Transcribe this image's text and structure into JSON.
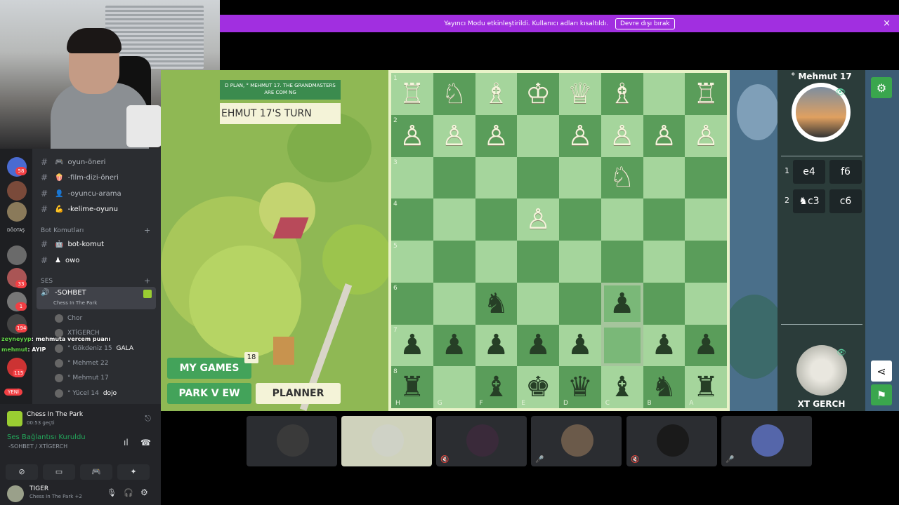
{
  "banner": {
    "message": "Yayıncı Modu etkinleştirildi. Kullanıcı adları kısaltıldı.",
    "disable_button": "Devre dışı bırak",
    "close_icon": "×"
  },
  "sidebar": {
    "channels": [
      {
        "icon": "🎮",
        "label": "oyun-öneri"
      },
      {
        "icon": "🍿",
        "label": "-film-dizi-öneri"
      },
      {
        "icon": "👤",
        "label": "-oyuncu-arama"
      },
      {
        "icon": "💪",
        "label": "-kelime-oyunu"
      }
    ],
    "server_label": "DĞOTAŞ",
    "server_badges": [
      "58",
      "33",
      "1",
      "194",
      "115"
    ],
    "new_badge": "YENİ",
    "category_bots": "Bot Komutları",
    "bot_channels": [
      {
        "icon": "🤖",
        "label": "bot-komut"
      },
      {
        "icon": "♟",
        "label": "owo"
      }
    ],
    "category_voice": "SES",
    "voice_channel": {
      "label": "-SOHBET",
      "activity": "Chess In The Park"
    },
    "voice_users": [
      {
        "name": "Chor",
        "extra": ""
      },
      {
        "name": "XTİGERCH",
        "extra": ""
      },
      {
        "name": "° Gökdeniz 15",
        "extra": "GALA"
      },
      {
        "name": "° Mehmet 22",
        "extra": ""
      },
      {
        "name": "° Mehmut 17",
        "extra": ""
      },
      {
        "name": "° Yücel 14",
        "extra": "dojo"
      }
    ],
    "chat_overlay": [
      {
        "name": "zeyneyyp",
        "text": ": mehmuta vercem puanı"
      },
      {
        "name": "mehmut",
        "text": ": AYIP"
      }
    ]
  },
  "activity": {
    "title": "Chess In The Park",
    "elapsed": "00:53 geçti",
    "voice_status": "Ses Bağlantısı Kuruldu",
    "voice_channel": "-SOHBET / XTİGERCH"
  },
  "userbar": {
    "name": "TIGER",
    "status": "Chess In The Park +2"
  },
  "game": {
    "plan_text": "D PLAN, ° MEHMUT 17. THE GRANDMASTERS ARE COM NG",
    "turn_text": "EHMUT 17'S TURN",
    "my_games": "MY GAMES",
    "my_games_count": "18",
    "park_view": "PARK V EW",
    "planner": "PLANNER",
    "board_rows": [
      [
        "♖",
        "♘",
        "♗",
        "♔",
        "♕",
        "♗",
        "",
        "♖"
      ],
      [
        "♙",
        "♙",
        "♙",
        "",
        "♙",
        "♙",
        "♙",
        "♙"
      ],
      [
        "",
        "",
        "",
        "",
        "",
        "♘",
        "",
        ""
      ],
      [
        "",
        "",
        "",
        "♙",
        "",
        "",
        "",
        ""
      ],
      [
        "",
        "",
        "",
        "",
        "",
        "",
        "",
        ""
      ],
      [
        "",
        "",
        "♞",
        "",
        "",
        "♟",
        "",
        ""
      ],
      [
        "♟",
        "♟",
        "♟",
        "♟",
        "♟",
        "",
        "♟",
        "♟"
      ],
      [
        "♜",
        "",
        "♝",
        "♚",
        "♛",
        "♝",
        "♞",
        "♜"
      ]
    ],
    "rank_labels": [
      "1",
      "2",
      "3",
      "4",
      "5",
      "6",
      "7",
      "8"
    ],
    "file_labels": [
      "H",
      "G",
      "F",
      "E",
      "D",
      "C",
      "B",
      "A"
    ],
    "opponent_top": "° Mehmut 17",
    "opponent_bottom": "XT GERCH",
    "moves": [
      {
        "num": "1",
        "white": "e4",
        "black": "f6"
      },
      {
        "num": "2",
        "white": "♞c3",
        "black": "c6"
      }
    ]
  },
  "tiles": [
    {
      "mute": "",
      "color": "#3a3a3a"
    },
    {
      "mute": "",
      "color": "#cfd2c6"
    },
    {
      "mute": "🔇",
      "color": "#3a2a3a"
    },
    {
      "mute": "🎤",
      "color": "#6b5a4a"
    },
    {
      "mute": "🔇",
      "color": "#1a1a1a"
    },
    {
      "mute": "🎤",
      "color": "#5566aa"
    }
  ]
}
